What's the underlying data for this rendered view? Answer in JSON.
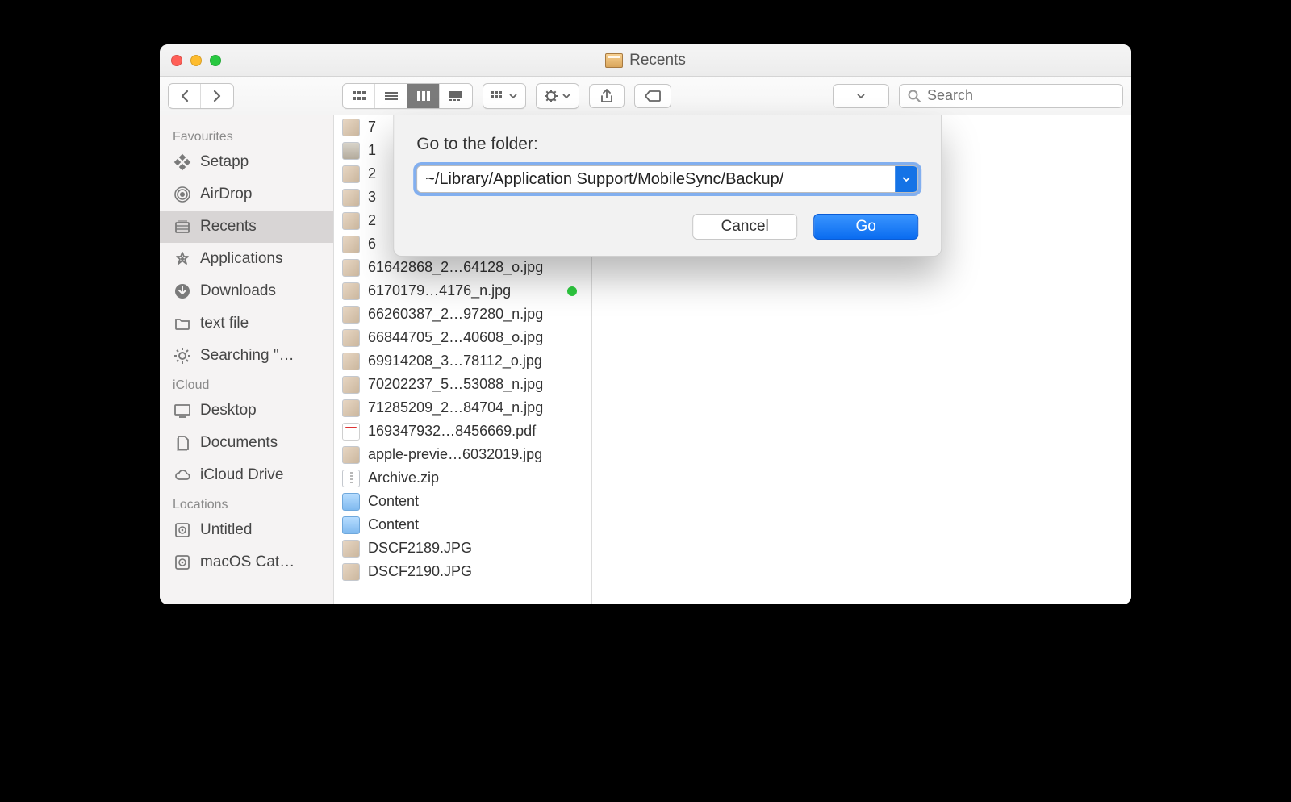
{
  "window": {
    "title": "Recents"
  },
  "search": {
    "placeholder": "Search"
  },
  "sidebar": {
    "sections": [
      {
        "header": "Favourites",
        "items": [
          {
            "label": "Setapp",
            "icon": "setapp"
          },
          {
            "label": "AirDrop",
            "icon": "airdrop"
          },
          {
            "label": "Recents",
            "icon": "recents",
            "selected": true
          },
          {
            "label": "Applications",
            "icon": "applications"
          },
          {
            "label": "Downloads",
            "icon": "downloads"
          },
          {
            "label": "text file",
            "icon": "folder"
          },
          {
            "label": "Searching \"…",
            "icon": "gear"
          }
        ]
      },
      {
        "header": "iCloud",
        "items": [
          {
            "label": "Desktop",
            "icon": "desktop"
          },
          {
            "label": "Documents",
            "icon": "documents"
          },
          {
            "label": "iCloud Drive",
            "icon": "cloud"
          }
        ]
      },
      {
        "header": "Locations",
        "items": [
          {
            "label": "Untitled",
            "icon": "disk"
          },
          {
            "label": "macOS Cat…",
            "icon": "disk"
          }
        ]
      }
    ]
  },
  "files": [
    {
      "name": "7",
      "kind": "img"
    },
    {
      "name": "1",
      "kind": "box"
    },
    {
      "name": "2",
      "kind": "img"
    },
    {
      "name": "3",
      "kind": "img"
    },
    {
      "name": "2",
      "kind": "img"
    },
    {
      "name": "6",
      "kind": "img"
    },
    {
      "name": "61642868_2…64128_o.jpg",
      "kind": "img"
    },
    {
      "name": "6170179…4176_n.jpg",
      "kind": "img",
      "tag": "green"
    },
    {
      "name": "66260387_2…97280_n.jpg",
      "kind": "img"
    },
    {
      "name": "66844705_2…40608_o.jpg",
      "kind": "img"
    },
    {
      "name": "69914208_3…78112_o.jpg",
      "kind": "img"
    },
    {
      "name": "70202237_5…53088_n.jpg",
      "kind": "img"
    },
    {
      "name": "71285209_2…84704_n.jpg",
      "kind": "img"
    },
    {
      "name": "169347932…8456669.pdf",
      "kind": "pdf"
    },
    {
      "name": "apple-previe…6032019.jpg",
      "kind": "img"
    },
    {
      "name": "Archive.zip",
      "kind": "zip"
    },
    {
      "name": "Content",
      "kind": "folder"
    },
    {
      "name": "Content",
      "kind": "folder"
    },
    {
      "name": "DSCF2189.JPG",
      "kind": "img"
    },
    {
      "name": "DSCF2190.JPG",
      "kind": "img"
    }
  ],
  "dialog": {
    "label": "Go to the folder:",
    "value": "~/Library/Application Support/MobileSync/Backup/",
    "cancel": "Cancel",
    "go": "Go"
  }
}
